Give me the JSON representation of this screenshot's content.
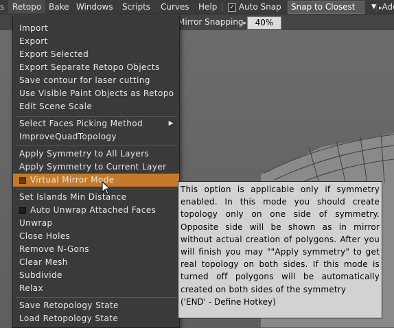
{
  "menubar": {
    "items": [
      {
        "name": "menu-retopo",
        "label": "Retopo",
        "active": true
      },
      {
        "name": "menu-bake",
        "label": "Bake"
      },
      {
        "name": "menu-windows",
        "label": "Windows"
      },
      {
        "name": "menu-scripts",
        "label": "Scripts"
      },
      {
        "name": "menu-curves",
        "label": "Curves"
      },
      {
        "name": "menu-help",
        "label": "Help"
      }
    ],
    "auto_snap_label": "Auto Snap",
    "snap_mode_value": "Snap to Closest",
    "add_label": "Add"
  },
  "toolbar": {
    "mirror_snapping_label": "Mirror Snapping",
    "mirror_snapping_value": "40%"
  },
  "menu": {
    "items": [
      {
        "label": "Import"
      },
      {
        "label": "Export"
      },
      {
        "label": "Export Selected"
      },
      {
        "label": "Export Separate Retopo Objects"
      },
      {
        "label": "Save contour for laser cutting"
      },
      {
        "label": "Use Visible Paint Objects as Retopo"
      },
      {
        "label": "Edit Scene Scale"
      },
      {
        "label": "Select Faces Picking Method",
        "submenu": true
      },
      {
        "label": "ImproveQuadTopology"
      },
      {
        "label": "Apply Symmetry to All Layers"
      },
      {
        "label": "Apply Symmetry to Current Layer"
      },
      {
        "label": "Virtual Mirror Mode",
        "checkbox": true,
        "highlighted": true
      },
      {
        "label": "Set Islands Min Distance"
      },
      {
        "label": "Auto Unwrap Attached Faces",
        "checkbox": true
      },
      {
        "label": "Unwrap"
      },
      {
        "label": "Close Holes"
      },
      {
        "label": "Remove N-Gons"
      },
      {
        "label": "Clear Mesh"
      },
      {
        "label": "Subdivide"
      },
      {
        "label": "Relax"
      },
      {
        "label": "Save Retopology State"
      },
      {
        "label": "Load Retopology State"
      }
    ]
  },
  "tooltip": {
    "text": "This option is applicable only if symmetry enabled. In this mode you should create topology only on one side of symmetry. Opposite side will be shown as in mirror without actual creation of polygons. After you will finish you may \"\"Apply symmetry\" to get real topology on both sides. If this mode is turned off polygons will be automatically created on both sides of the symmetry",
    "hotkey": "('END' - Define Hotkey)"
  },
  "colors": {
    "highlight": "#c67a29",
    "menu_bg": "#3a3a3a",
    "tooltip_bg": "#d2d2d2"
  }
}
